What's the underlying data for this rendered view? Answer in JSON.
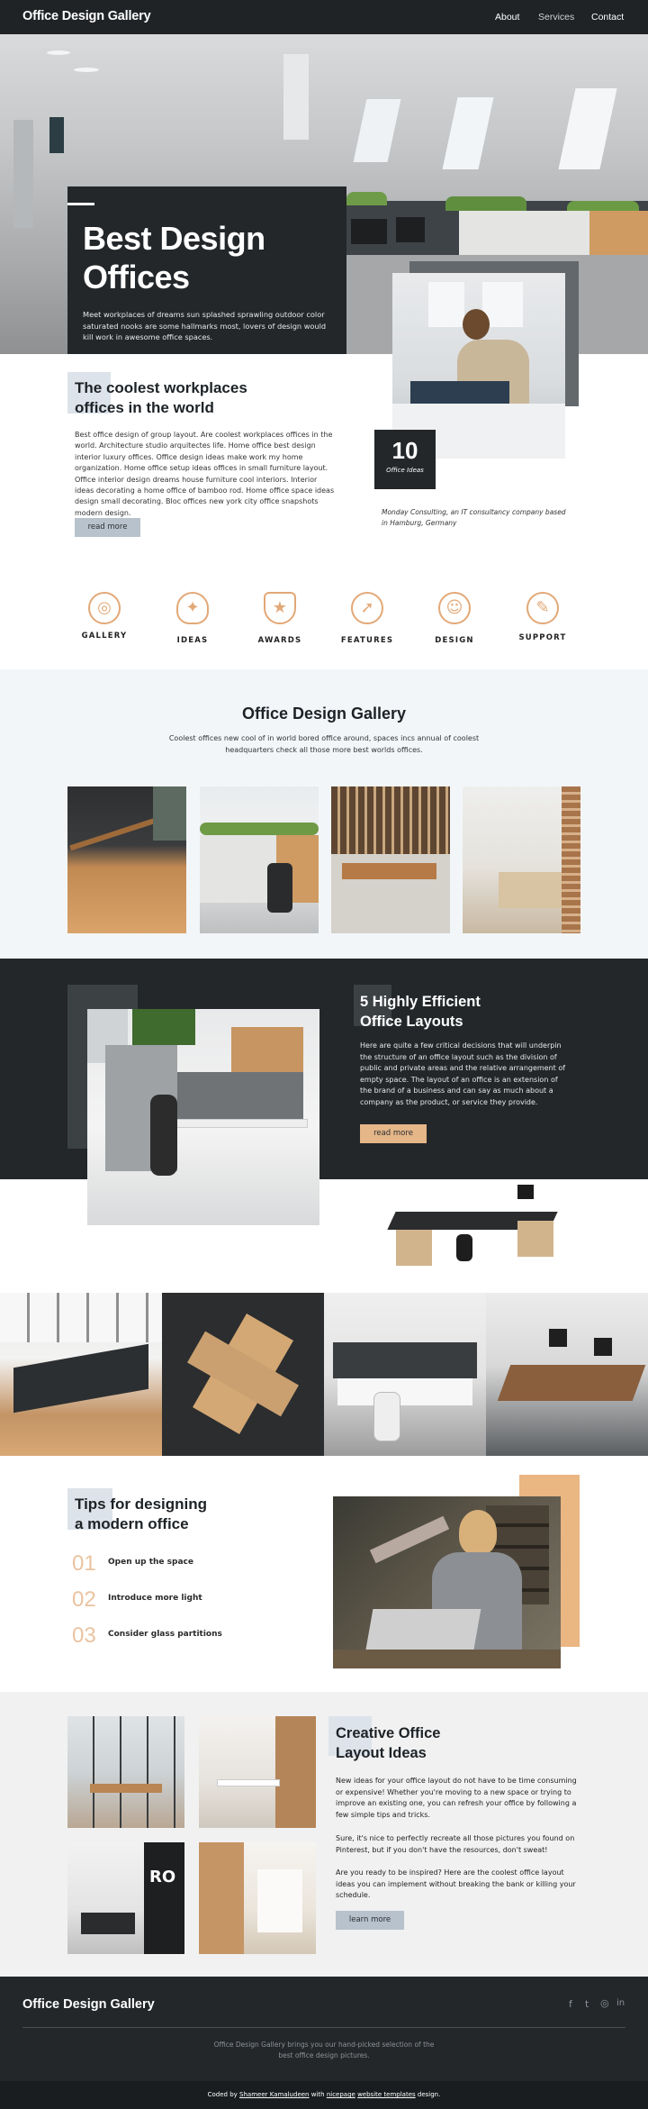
{
  "header": {
    "logo": "Office Design Gallery",
    "nav": [
      "About",
      "Services",
      "Contact"
    ]
  },
  "hero": {
    "title_line1": "Best Design",
    "title_line2": "Offices",
    "text": "Meet workplaces of dreams sun splashed sprawling outdoor color saturated nooks are some hallmarks most, lovers of design would kill work in awesome office spaces."
  },
  "intro": {
    "title_line1": "The coolest workplaces",
    "title_line2": "offices in the world",
    "text": "Best office design of group layout. Are coolest workplaces offices in the world. Architecture studio arquitectes life. Home office best design interior luxury offices. Office design ideas make work my home organization. Home office setup ideas offices in small furniture layout. Office interior design dreams house furniture cool interiors. Interior ideas decorating a home office of bamboo rod. Home office space ideas design small decorating. Bloc offices new york city office snapshots modern design.",
    "button": "read more",
    "stat_number": "10",
    "stat_label": "Office Ideas",
    "caption": "Monday Consulting, an IT consultancy company based in Hamburg, Germany"
  },
  "features": [
    {
      "label": "GALLERY",
      "icon": "camera-icon"
    },
    {
      "label": "IDEAS",
      "icon": "lightbulb-icon"
    },
    {
      "label": "AWARDS",
      "icon": "trophy-icon"
    },
    {
      "label": "FEATURES",
      "icon": "rocket-icon"
    },
    {
      "label": "DESIGN",
      "icon": "designer-icon"
    },
    {
      "label": "SUPPORT",
      "icon": "support-icon"
    }
  ],
  "gallery": {
    "title": "Office Design Gallery",
    "subtitle": "Coolest offices new cool of in world bored office around, spaces incs annual of coolest headquarters check all those more best worlds offices."
  },
  "layouts": {
    "title_line1": "5 Highly Efficient",
    "title_line2": "Office Layouts",
    "text": "Here are quite a few critical decisions that will underpin the structure of an office layout such as the division of public and private areas and the relative arrangement of empty space. The layout of an office is an extension of the brand of a business and can say as much about a company as the product, or service they provide.",
    "button": "read more"
  },
  "tips": {
    "title_line1": "Tips for designing",
    "title_line2": "a modern office",
    "items": [
      {
        "num": "01",
        "text": "Open up the space"
      },
      {
        "num": "02",
        "text": "Introduce more light"
      },
      {
        "num": "03",
        "text": "Consider glass partitions"
      }
    ]
  },
  "creative": {
    "title_line1": "Creative Office",
    "title_line2": "Layout Ideas",
    "p1": "New ideas for your office layout do not have to be time consuming or expensive! Whether you're moving to a new space or trying to improve an existing one, you can refresh your office by following a few simple tips and tricks.",
    "p2": "Sure, it's nice to perfectly recreate all those pictures you found on Pinterest, but if you don't have the resources, don't sweat!",
    "p3": "Are you ready to be inspired? Here are the coolest office layout ideas you can implement without breaking the bank or killing your schedule.",
    "button": "learn more"
  },
  "footer": {
    "logo": "Office Design Gallery",
    "social": [
      "f",
      "t",
      "◎",
      "in"
    ],
    "text": "Office Design Gallery brings you our hand-picked selection of the best office design pictures.",
    "credit_prefix": "Coded by ",
    "credit_author": "Shameer Kamaludeen",
    "credit_mid": " with ",
    "credit_tool": "nicepage",
    "credit_link": "website templates",
    "credit_suffix": " design."
  },
  "colors": {
    "dark": "#23272a",
    "accent": "#e5b688",
    "light": "#f3f6f9",
    "highlight": "#dde3ea"
  }
}
